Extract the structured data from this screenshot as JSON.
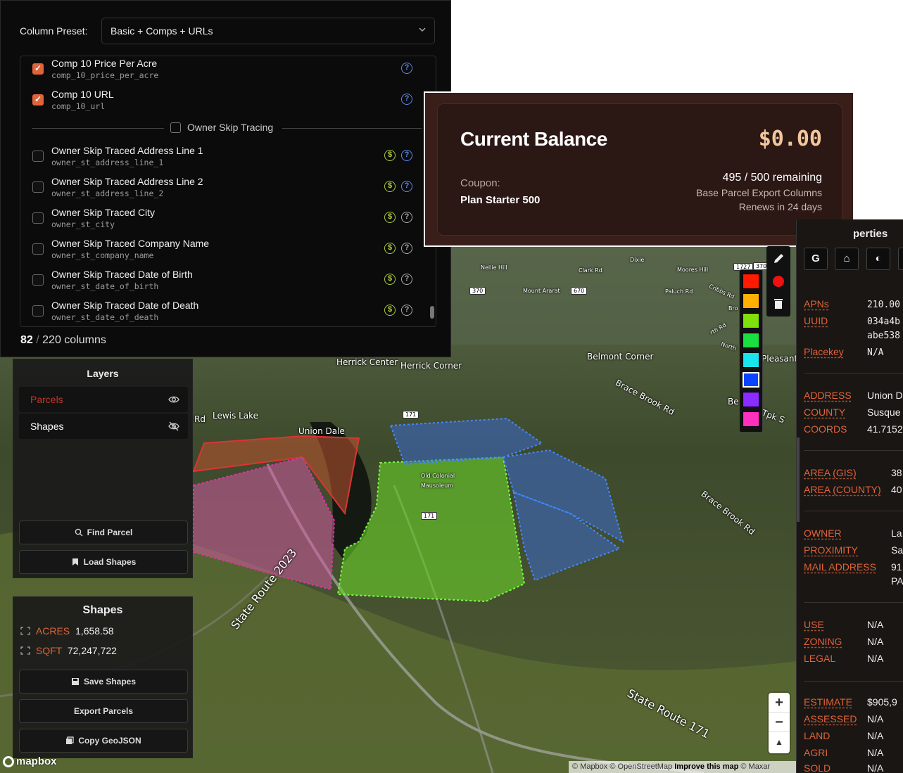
{
  "column_panel": {
    "preset_label": "Column Preset:",
    "preset_value": "Basic + Comps + URLs",
    "items": [
      {
        "title": "Comp 10 Price Per Acre",
        "key": "comp_10_price_per_acre",
        "checked": true,
        "paid": false
      },
      {
        "title": "Comp 10 URL",
        "key": "comp_10_url",
        "checked": true,
        "paid": false
      },
      {
        "title": "Owner Skip Traced Address Line 1",
        "key": "owner_st_address_line_1",
        "checked": false,
        "paid": true
      },
      {
        "title": "Owner Skip Traced Address Line 2",
        "key": "owner_st_address_line_2",
        "checked": false,
        "paid": true
      },
      {
        "title": "Owner Skip Traced City",
        "key": "owner_st_city",
        "checked": false,
        "paid": true
      },
      {
        "title": "Owner Skip Traced Company Name",
        "key": "owner_st_company_name",
        "checked": false,
        "paid": true
      },
      {
        "title": "Owner Skip Traced Date of Birth",
        "key": "owner_st_date_of_birth",
        "checked": false,
        "paid": true
      },
      {
        "title": "Owner Skip Traced Date of Death",
        "key": "owner_st_date_of_death",
        "checked": false,
        "paid": true
      }
    ],
    "group_label": "Owner Skip Tracing",
    "count_selected": "82",
    "count_sep": "/",
    "count_total": "220 columns"
  },
  "balance": {
    "title": "Current Balance",
    "amount": "$0.00",
    "coupon_label": "Coupon:",
    "coupon_value": "Plan Starter 500",
    "remaining": "495 / 500 remaining",
    "plan_desc": "Base Parcel Export Columns",
    "renews": "Renews in 24 days"
  },
  "layers": {
    "title": "Layers",
    "items": [
      {
        "name": "Parcels",
        "visible": true,
        "color": "#c0392b"
      },
      {
        "name": "Shapes",
        "visible": false,
        "color": "#ffffff"
      }
    ],
    "find_parcel": "Find Parcel",
    "load_shapes": "Load Shapes"
  },
  "shapes": {
    "title": "Shapes",
    "acres_label": "ACRES",
    "acres_value": "1,658.58",
    "sqft_label": "SQFT",
    "sqft_value": "72,247,722",
    "save": "Save Shapes",
    "export": "Export Parcels",
    "copy": "Copy GeoJSON"
  },
  "palette": [
    "#ff1a00",
    "#ffb000",
    "#7fe00a",
    "#1adf40",
    "#19e5ef",
    "#0a44ff",
    "#8a2bff",
    "#ff2fbf"
  ],
  "palette_selected": 5,
  "map": {
    "labels": [
      {
        "text": "Herrick Center",
        "cls": ""
      },
      {
        "text": "Herrick Corner",
        "cls": ""
      },
      {
        "text": "Belmont Corner",
        "cls": ""
      },
      {
        "text": "Lewis Lake",
        "cls": ""
      },
      {
        "text": "Union Dale",
        "cls": ""
      },
      {
        "text": "Old Colonial",
        "cls": "small"
      },
      {
        "text": "Mausoleum",
        "cls": "small"
      },
      {
        "text": "Brace Brook Rd",
        "cls": ""
      },
      {
        "text": "Brace Brook Rd",
        "cls": ""
      },
      {
        "text": "State Route 2023",
        "cls": "road"
      },
      {
        "text": "State Route 171",
        "cls": "road"
      },
      {
        "text": "Mount Ararat",
        "cls": "small"
      },
      {
        "text": "Paluch Rd",
        "cls": "small"
      },
      {
        "text": "Cribbs Rd",
        "cls": "small"
      },
      {
        "text": "Pleasant I",
        "cls": ""
      },
      {
        "text": "Rd",
        "cls": ""
      },
      {
        "text": "Dixie",
        "cls": "small"
      },
      {
        "text": "Nellie Hill",
        "cls": "small"
      },
      {
        "text": "Clark Rd",
        "cls": "small"
      },
      {
        "text": "Moores Hill",
        "cls": "small"
      },
      {
        "text": "Tpk S",
        "cls": ""
      },
      {
        "text": "Be",
        "cls": ""
      },
      {
        "text": "North",
        "cls": "small"
      },
      {
        "text": "rth Rd",
        "cls": "small"
      },
      {
        "text": "Bro",
        "cls": "small"
      }
    ],
    "shields": [
      "171",
      "171",
      "370",
      "670",
      "1727",
      "370"
    ],
    "attribution_1": "© Mapbox © OpenStreetMap ",
    "attribution_bold": "Improve this map",
    "attribution_2": " © Maxar",
    "logo": "mapbox"
  },
  "properties": {
    "title_fragment": "perties",
    "rows": [
      {
        "k": "APNs",
        "v": "210.00",
        "mono": true
      },
      {
        "k": "UUID",
        "v": "034a4b",
        "mono": true
      },
      {
        "k": "",
        "v": "abe538",
        "mono": true
      },
      {
        "k": "Placekey",
        "v": "N/A",
        "mono": true
      },
      {
        "k": "ADDRESS",
        "v": "Union D",
        "mono": false
      },
      {
        "k": "COUNTY",
        "v": "Susque",
        "mono": false
      },
      {
        "k": "COORDS",
        "v": "41.7152",
        "mono": false
      },
      {
        "k": "AREA (GIS)",
        "v": "38",
        "mono": false
      },
      {
        "k": "AREA (COUNTY)",
        "v": "40",
        "mono": false
      },
      {
        "k": "OWNER",
        "v": "La",
        "mono": false
      },
      {
        "k": "PROXIMITY",
        "v": "Sa",
        "mono": false
      },
      {
        "k": "MAIL ADDRESS",
        "v": "91",
        "mono": false
      },
      {
        "k": "",
        "v": "PA",
        "mono": false
      },
      {
        "k": "USE",
        "v": "N/A",
        "mono": false
      },
      {
        "k": "ZONING",
        "v": "N/A",
        "mono": false
      },
      {
        "k": "LEGAL",
        "v": "N/A",
        "mono": false
      },
      {
        "k": "ESTIMATE",
        "v": "$905,9",
        "mono": false
      },
      {
        "k": "ASSESSED",
        "v": "N/A",
        "mono": false
      },
      {
        "k": "LAND",
        "v": "N/A",
        "mono": false
      },
      {
        "k": "AGRI",
        "v": "N/A",
        "mono": false
      },
      {
        "k": "SOLD",
        "v": "N/A",
        "mono": false
      }
    ],
    "tool_g": "G"
  },
  "zoom": {
    "in": "+",
    "out": "−"
  }
}
